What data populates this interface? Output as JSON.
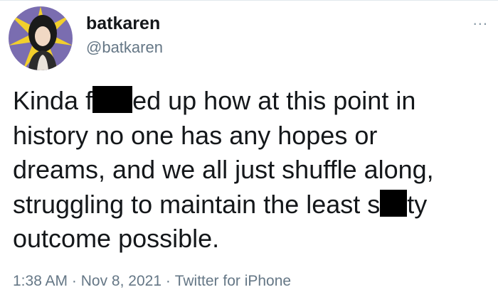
{
  "user": {
    "display_name": "batkaren",
    "handle": "@batkaren",
    "avatar_icon": "avatar-illustration-icon"
  },
  "menu": {
    "more_label": "..."
  },
  "tweet": {
    "line1_a": "Kinda f",
    "line1_b": "ed up how at this point in",
    "line2": "history no one has any hopes or",
    "line3": "dreams, and we all just shuffle along,",
    "line4_a": "struggling to maintain the least s",
    "line4_b": "ty",
    "line5": "outcome possible."
  },
  "meta": {
    "time": "1:38 AM",
    "sep1": "·",
    "date": "Nov 8, 2021",
    "sep2": "·",
    "source": "Twitter for iPhone"
  },
  "colors": {
    "text": "#14171a",
    "secondary": "#657786",
    "avatar_bg": "#7a6db0",
    "avatar_accent": "#f2cf2c"
  }
}
